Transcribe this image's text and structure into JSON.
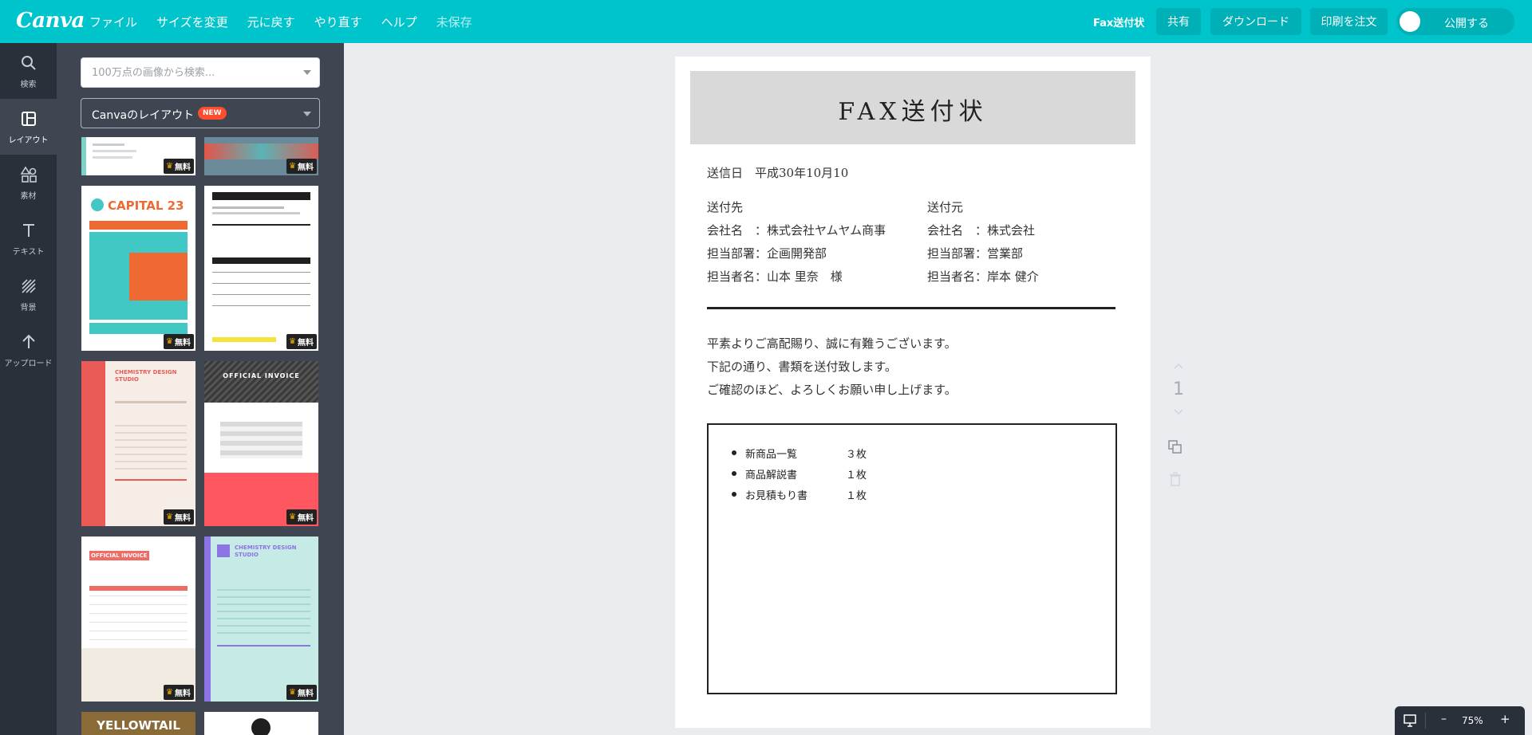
{
  "topbar": {
    "logo": "Canva",
    "menu": [
      "ファイル",
      "サイズを変更",
      "元に戻す",
      "やり直す",
      "ヘルプ",
      "未保存"
    ],
    "doc_title": "Fax送付状",
    "share": "共有",
    "download": "ダウンロード",
    "print": "印刷を注文",
    "publish": "公開する"
  },
  "nav": [
    {
      "label": "検索",
      "icon": "search-icon"
    },
    {
      "label": "レイアウト",
      "icon": "layout-icon"
    },
    {
      "label": "素材",
      "icon": "elements-icon"
    },
    {
      "label": "テキスト",
      "icon": "text-icon"
    },
    {
      "label": "背景",
      "icon": "background-icon"
    },
    {
      "label": "アップロード",
      "icon": "upload-icon"
    }
  ],
  "panel": {
    "search_placeholder": "100万点の画像から検索...",
    "layout_label": "Canvaのレイアウト",
    "new_badge": "NEW",
    "free_label": "無料"
  },
  "templates": [
    {
      "title": "",
      "color": "#7fd1c7"
    },
    {
      "title": "",
      "color": "#e2554a"
    },
    {
      "title": "CAPITAL 23",
      "color": "#41c7c4"
    },
    {
      "title": "",
      "color": "#1f1f1f"
    },
    {
      "title": "CHEMISTRY DESIGN STUDIO",
      "color": "#ea5a56"
    },
    {
      "title": "OFFICIAL INVOICE",
      "color": "#ff5760"
    },
    {
      "title": "OFFICIAL INVOICE",
      "color": "#ef6b64"
    },
    {
      "title": "CHEMISTRY DESIGN STUDIO",
      "color": "#a8e1dc"
    },
    {
      "title": "YELLOWTAIL",
      "color": "#c7983c"
    },
    {
      "title": "",
      "color": "#ffffff"
    }
  ],
  "document": {
    "title": "FAX送付状",
    "date": "送信日　平成30年10月10",
    "to_heading": "送付先",
    "from_heading": "送付元",
    "to_lines": [
      "会社名　：株式会社ヤムヤム商事",
      "担当部署：企画開発部",
      "担当者名：山本 里奈　様"
    ],
    "from_lines": [
      "会社名　：株式会社",
      "担当部署：営業部",
      "担当者名：岸本 健介"
    ],
    "body": [
      "平素よりご高配賜り、誠に有難うございます。",
      "下記の通り、書類を送付致します。",
      "ご確認のほど、よろしくお願い申し上げます。"
    ],
    "items": [
      {
        "name": "新商品一覧",
        "qty": "３枚"
      },
      {
        "name": "商品解説書",
        "qty": "１枚"
      },
      {
        "name": "お見積もり書",
        "qty": "１枚"
      }
    ]
  },
  "page_number": "1",
  "zoom": {
    "level": "75%",
    "minus": "–",
    "plus": "+"
  }
}
